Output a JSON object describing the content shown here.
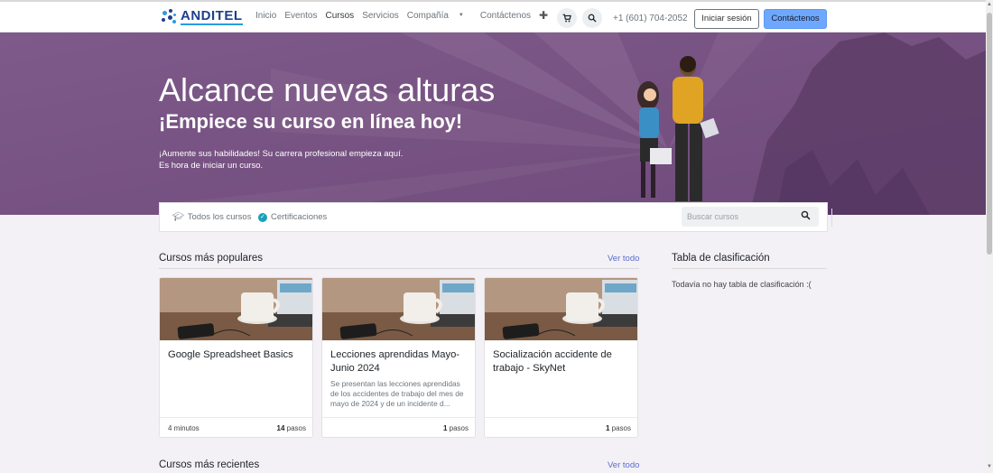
{
  "brand": {
    "name": "ANDITEL"
  },
  "nav": {
    "items": [
      {
        "label": "Inicio"
      },
      {
        "label": "Eventos"
      },
      {
        "label": "Cursos"
      },
      {
        "label": "Servicios"
      },
      {
        "label": "Compañía"
      },
      {
        "label": "Contáctenos"
      }
    ],
    "active": "Cursos",
    "phone": "+1 (601) 704-2052",
    "login_label": "Iniciar sesión",
    "contact_label": "Contáctenos",
    "icons": [
      "cart-icon",
      "search-icon",
      "plus-icon"
    ]
  },
  "hero": {
    "title": "Alcance nuevas alturas",
    "subtitle": "¡Empiece su curso en línea hoy!",
    "line1": "¡Aumente sus habilidades! Su carrera profesional empieza aquí.",
    "line2": "Es hora de iniciar un curso."
  },
  "filters": {
    "all_courses": "Todos los cursos",
    "certifications": "Certificaciones",
    "search_placeholder": "Buscar cursos"
  },
  "popular": {
    "title": "Cursos más populares",
    "link": "Ver todo",
    "cards": [
      {
        "title": "Google Spreadsheet Basics",
        "description": "",
        "duration": "4 minutos",
        "steps_count": "14",
        "steps_label": "pasos"
      },
      {
        "title": "Lecciones aprendidas Mayo-Junio 2024",
        "description": "Se presentan las lecciones aprendidas de los accidentes de trabajo del mes de mayo de 2024 y de un incidente d...",
        "duration": "",
        "steps_count": "1",
        "steps_label": "pasos"
      },
      {
        "title": "Socialización accidente de trabajo - SkyNet",
        "description": "",
        "duration": "",
        "steps_count": "1",
        "steps_label": "pasos"
      }
    ]
  },
  "leaderboard": {
    "title": "Tabla de clasificación",
    "empty": "Todavía no hay tabla de clasificación :("
  },
  "recent": {
    "title": "Cursos más recientes",
    "link": "Ver todo"
  },
  "colors": {
    "hero_bg": "#7a5585",
    "primary_button": "#6ea8fe",
    "link": "#5b6dcd",
    "brand": "#1d3f8c"
  }
}
